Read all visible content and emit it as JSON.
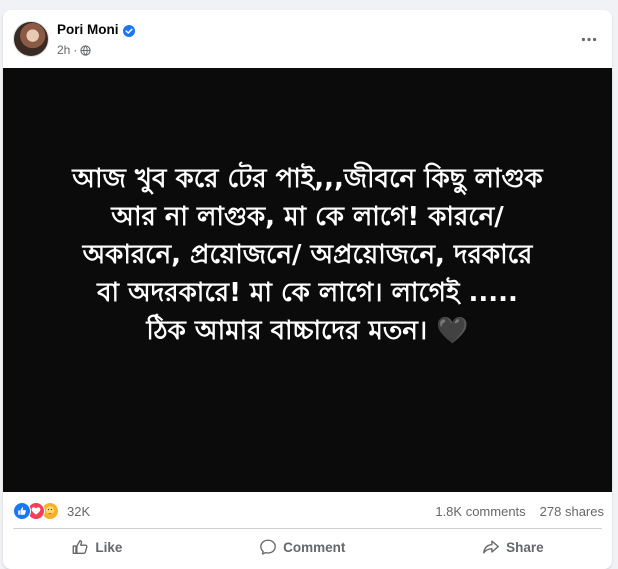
{
  "post": {
    "author": "Pori Moni",
    "time": "2h",
    "text": "আজ খুব করে টের পাই,,,জীবনে কিছু লাগুক\nআর না লাগুক, মা কে লাগে! কারনে/\nঅকারনে, প্রয়োজনে/ অপ্রয়োজনে, দরকারে\nবা অদরকারে! মা কে লাগে। লাগেই .....\nঠিক আমার বাচ্চাদের মতন। 🖤"
  },
  "stats": {
    "reactions_count": "32K",
    "comments": "1.8K comments",
    "shares": "278 shares"
  },
  "reaction_icons": [
    "like-icon",
    "love-icon",
    "care-icon"
  ],
  "actions": {
    "like": "Like",
    "comment": "Comment",
    "share": "Share"
  },
  "colors": {
    "like": "#1877f2",
    "love": "#f33e58",
    "care": "#f7b125",
    "verified": "#1877f2"
  }
}
